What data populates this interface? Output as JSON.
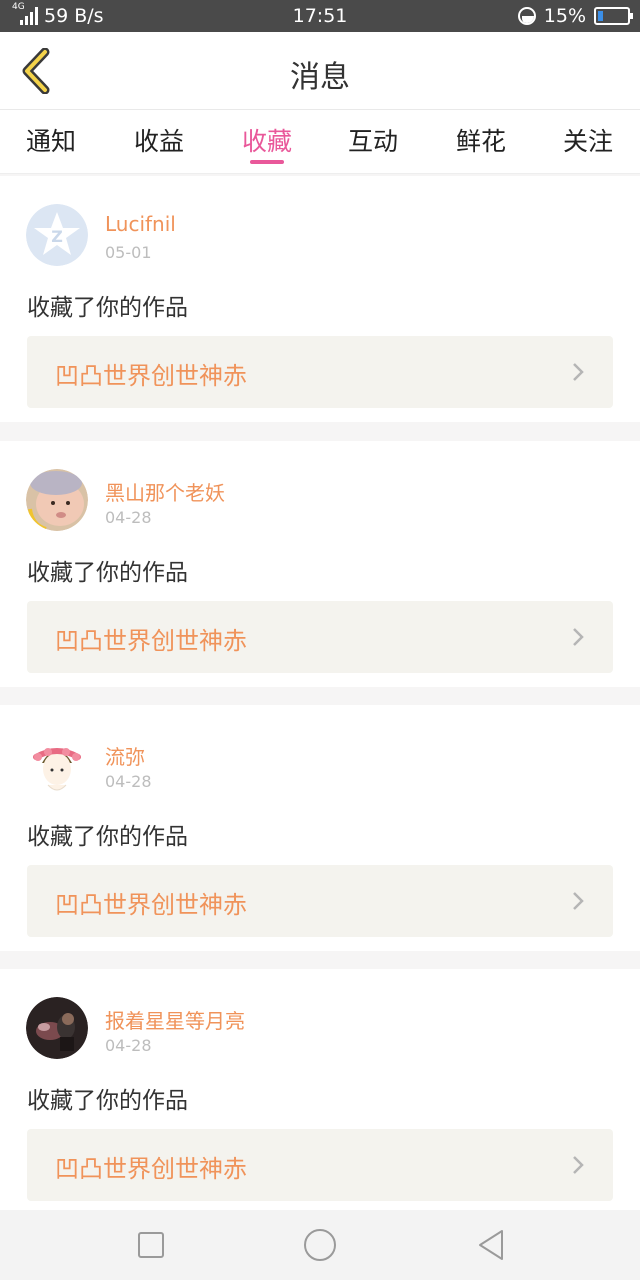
{
  "status_bar": {
    "network": "4G",
    "speed": "59 B/s",
    "time": "17:51",
    "battery": "15%"
  },
  "header": {
    "title": "消息",
    "back_icon": "chevron-left-icon"
  },
  "tabs": [
    {
      "label": "通知",
      "active": false
    },
    {
      "label": "收益",
      "active": false
    },
    {
      "label": "收藏",
      "active": true
    },
    {
      "label": "互动",
      "active": false
    },
    {
      "label": "鲜花",
      "active": false
    },
    {
      "label": "关注",
      "active": false
    }
  ],
  "messages": [
    {
      "user": "Lucifnil",
      "date": "05-01",
      "action": "收藏了你的作品",
      "work": "凹凸世界创世神赤",
      "avatar": "qq-default-avatar"
    },
    {
      "user": "黑山那个老妖",
      "date": "04-28",
      "action": "收藏了你的作品",
      "work": "凹凸世界创世神赤",
      "avatar": "baby-photo-avatar"
    },
    {
      "user": "流弥",
      "date": "04-28",
      "action": "收藏了你的作品",
      "work": "凹凸世界创世神赤",
      "avatar": "cartoon-girl-avatar"
    },
    {
      "user": "报着星星等月亮",
      "date": "04-28",
      "action": "收藏了你的作品",
      "work": "凹凸世界创世神赤",
      "avatar": "dark-photo-avatar"
    }
  ],
  "nav_bar": {
    "icons": [
      "square-recents-icon",
      "circle-home-icon",
      "triangle-back-icon"
    ]
  },
  "colors": {
    "accent": "#e9589a",
    "username": "#f0935a",
    "work_box": "#f4f3ee"
  }
}
